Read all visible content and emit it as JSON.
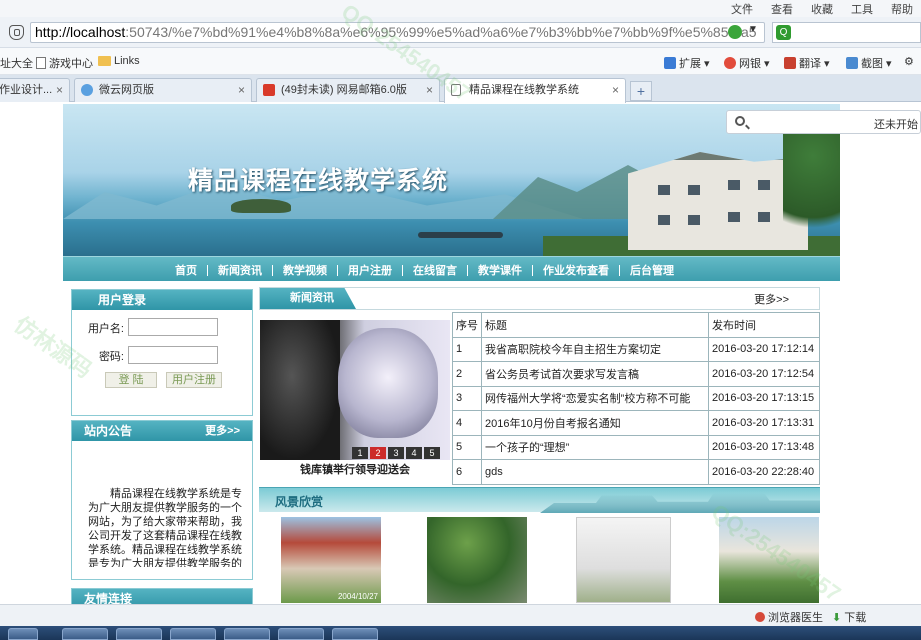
{
  "browser": {
    "menu": [
      "文件",
      "查看",
      "收藏",
      "工具",
      "帮助"
    ],
    "menu_overflow": "»",
    "url_host": "http://localhost",
    "url_rest": ":50743/%e7%bd%91%e4%b8%8a%e6%95%99%e5%ad%a6%e7%b3%bb%e7%bb%9f%e5%85%a5",
    "favorites": [
      "址大全",
      "游戏中心",
      "Links"
    ],
    "favbar_right": [
      "扩展",
      "网银",
      "翻译",
      "截图"
    ],
    "tabs": [
      {
        "label": "作业设计..."
      },
      {
        "label": "微云网页版"
      },
      {
        "label": "(49封未读) 网易邮箱6.0版"
      },
      {
        "label": "精品课程在线教学系统"
      }
    ],
    "new_tab_label": "+",
    "search_hint": "还未开始",
    "status_items": [
      "浏览器医生",
      "下载"
    ]
  },
  "site": {
    "title": "精品课程在线教学系统",
    "nav": [
      "首页",
      "新闻资讯",
      "教学视频",
      "用户注册",
      "在线留言",
      "教学课件",
      "作业发布查看",
      "后台管理"
    ],
    "login": {
      "title": "用户登录",
      "username_label": "用户名:",
      "password_label": "密码:",
      "login_button": "登 陆",
      "register_button": "用户注册"
    },
    "notice": {
      "title": "站内公告",
      "more": "更多>>",
      "text": "精品课程在线教学系统是专为广大朋友提供教学服务的一个网站，为了给大家带来帮助，我公司开发了这套精品课程在线教学系统。精品课程在线教学系统是专为广大朋友提供教学服务的一个网站，为了给大家带来帮助，我公司"
    },
    "friends": {
      "title": "友情连接"
    },
    "news": {
      "tab": "新闻资讯",
      "more": "更多>>",
      "slider_caption": "钱库镇举行领导迎送会",
      "slider_dots": [
        "1",
        "2",
        "3",
        "4",
        "5"
      ],
      "columns": [
        "序号",
        "标题",
        "发布时间"
      ],
      "rows": [
        {
          "no": "1",
          "title": "我省高职院校今年自主招生方案切定",
          "time": "2016-03-20 17:12:14"
        },
        {
          "no": "2",
          "title": "省公务员考试首次要求写发言稿",
          "time": "2016-03-20 17:12:54"
        },
        {
          "no": "3",
          "title": "网传福州大学将“恋爱实名制”校方称不可能",
          "time": "2016-03-20 17:13:15"
        },
        {
          "no": "4",
          "title": "2016年10月份自考报名通知",
          "time": "2016-03-20 17:13:31"
        },
        {
          "no": "5",
          "title": "一个孩子的“理想”",
          "time": "2016-03-20 17:13:48"
        },
        {
          "no": "6",
          "title": "gds",
          "time": "2016-03-20 22:28:40"
        }
      ]
    },
    "scenery": {
      "title": "风景欣赏",
      "photo_date": "2004/10/27"
    }
  },
  "watermark": [
    "仿林源码",
    "QQ:254540457"
  ]
}
